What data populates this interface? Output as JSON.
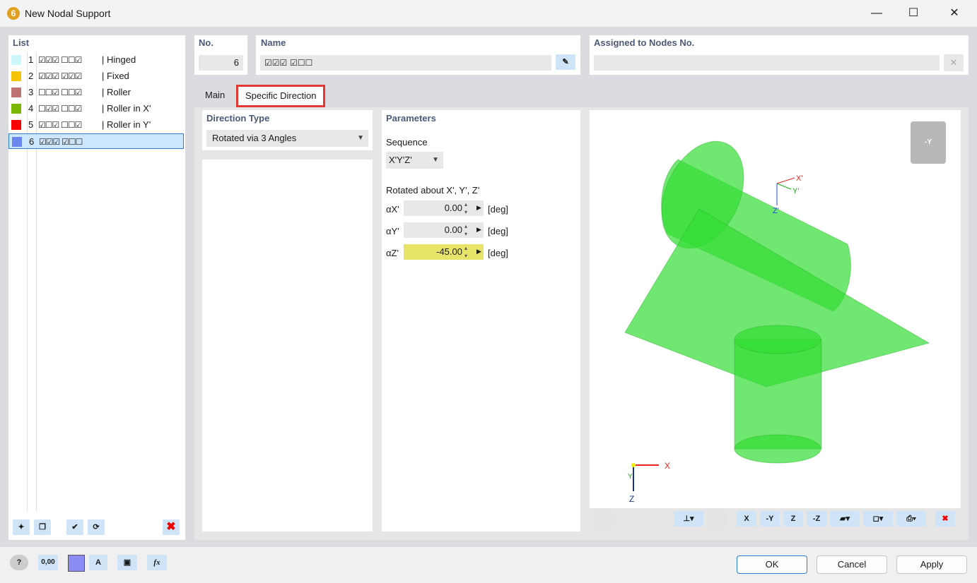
{
  "window": {
    "title": "New Nodal Support",
    "minimize": "—",
    "maximize": "☐",
    "close": "✕"
  },
  "list": {
    "header": "List",
    "items": [
      {
        "no": "1",
        "checks": "☑☑☑ ☐☐☑",
        "label": "| Hinged",
        "color": "#ccf7fb"
      },
      {
        "no": "2",
        "checks": "☑☑☑ ☑☑☑",
        "label": "| Fixed",
        "color": "#f5c400"
      },
      {
        "no": "3",
        "checks": "☐☐☑ ☐☐☑",
        "label": "| Roller",
        "color": "#bf7272"
      },
      {
        "no": "4",
        "checks": "☐☑☑ ☐☐☑",
        "label": "| Roller in X'",
        "color": "#7ab800"
      },
      {
        "no": "5",
        "checks": "☑☐☑ ☐☐☑",
        "label": "| Roller in Y'",
        "color": "#ff0000"
      },
      {
        "no": "6",
        "checks": "☑☑☑ ☑☐☐",
        "label": "",
        "color": "#6a87f0",
        "selected": true
      }
    ]
  },
  "no": {
    "label": "No.",
    "value": "6"
  },
  "name": {
    "label": "Name",
    "value": "☑☑☑ ☑☐☐"
  },
  "assigned": {
    "label": "Assigned to Nodes No.",
    "value": ""
  },
  "tabs": [
    {
      "label": "Main"
    },
    {
      "label": "Specific Direction",
      "active": true
    }
  ],
  "direction": {
    "header": "Direction Type",
    "value": "Rotated via 3 Angles"
  },
  "params": {
    "header": "Parameters",
    "sequence_label": "Sequence",
    "sequence": "X'Y'Z'",
    "rot_label": "Rotated about X', Y', Z'",
    "angles": [
      {
        "label": "αX'",
        "value": "0.00",
        "unit": "[deg]"
      },
      {
        "label": "αY'",
        "value": "0.00",
        "unit": "[deg]"
      },
      {
        "label": "αZ'",
        "value": "-45.00",
        "unit": "[deg]",
        "highlight": "#e8e46a"
      }
    ]
  },
  "viewer": {
    "local_x": "X'",
    "local_y": "Y'",
    "local_z": "Z'",
    "axis_x": "X",
    "axis_y": "Y",
    "axis_z": "Z",
    "cube_label": "-Y",
    "tb": {
      "x": "X",
      "y": "-Y",
      "z": "Z",
      "mz": "-Z"
    }
  },
  "buttons": {
    "ok": "OK",
    "cancel": "Cancel",
    "apply": "Apply"
  },
  "bottom_icons": {
    "units": "0,00",
    "fx": "fx"
  },
  "colors": {
    "accent": "#2a7fd4",
    "highlight_tab": "#e53935",
    "support_green": "#33dd33"
  }
}
